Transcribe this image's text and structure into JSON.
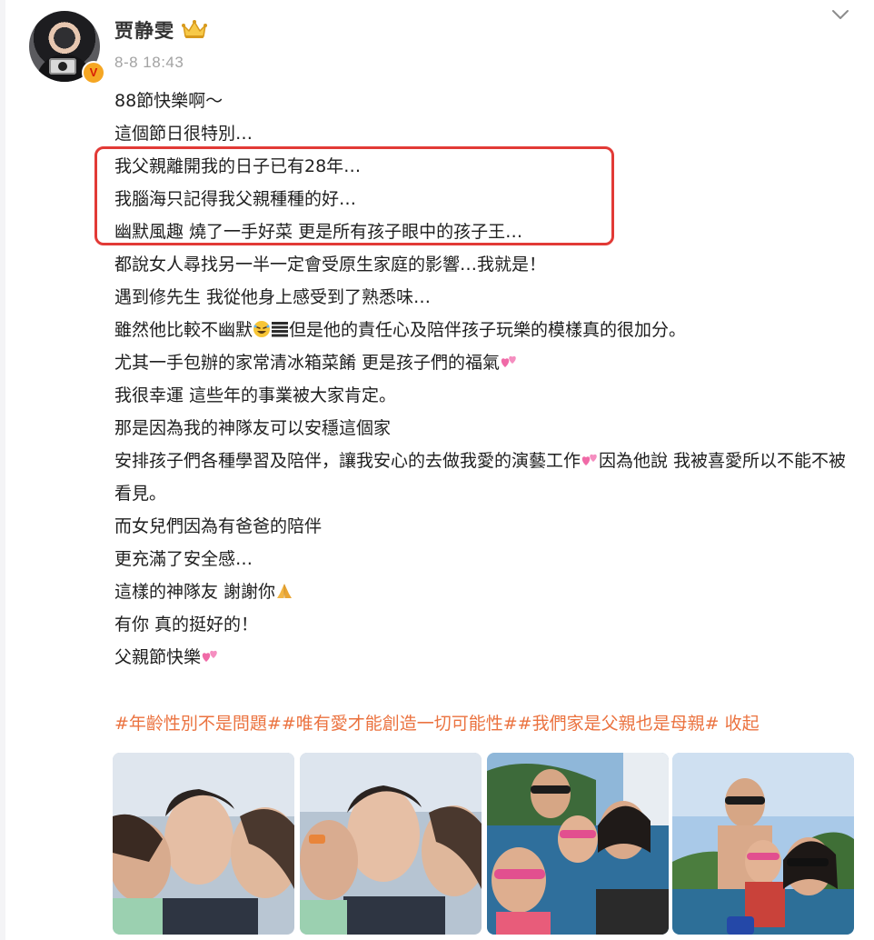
{
  "header": {
    "username": "贾静雯",
    "timestamp": "8-8 18:43",
    "avatar_icon": "avatar",
    "verified_icon": "verified-badge-icon",
    "verified_badge_text": "V",
    "crown_icon": "crown-icon",
    "menu_icon": "chevron-down-icon"
  },
  "post": {
    "lines": [
      "88節快樂啊～",
      "這個節日很特別…",
      "我父親離開我的日子已有28年…",
      "我腦海只記得我父親種種的好…",
      "幽默風趣 燒了一手好菜 更是所有孩子眼中的孩子王…",
      "都說女人尋找另一半一定會受原生家庭的影響…我就是！",
      "遇到修先生 我從他身上感受到了熟悉味…",
      "雖然他比較不幽默",
      "但是他的責任心及陪伴孩子玩樂的模樣真的很加分。",
      "尤其一手包辦的家常清冰箱菜餚 更是孩子們的福氣",
      "我很幸運 這些年的事業被大家肯定。",
      "那是因為我的神隊友可以安穩這個家",
      "安排孩子們各種學習及陪伴，讓我安心的去做我愛的演藝工作",
      "因為他說 我被喜愛所以不能不被看見。",
      "而女兒們因為有爸爸的陪伴",
      "更充滿了安全感…",
      "這樣的神隊友 謝謝你",
      "有你 真的挺好的！",
      "父親節快樂"
    ],
    "emojis": [
      "rofl-emoji",
      "black-bars-emoji",
      "two-hearts-emoji",
      "praying-hands-emoji"
    ]
  },
  "hashtags": {
    "text": "#年齡性別不是問題##唯有愛才能創造一切可能性##我們家是父親也是母親#",
    "collapse_label": " 收起"
  },
  "photos": [
    {
      "name": "photo-1"
    },
    {
      "name": "photo-2"
    },
    {
      "name": "photo-3"
    },
    {
      "name": "photo-4"
    }
  ],
  "colors": {
    "highlight_border": "#e23a36",
    "hashtag": "#eb7340",
    "timestamp": "#a3a3a3",
    "verified": "#f5a623"
  }
}
